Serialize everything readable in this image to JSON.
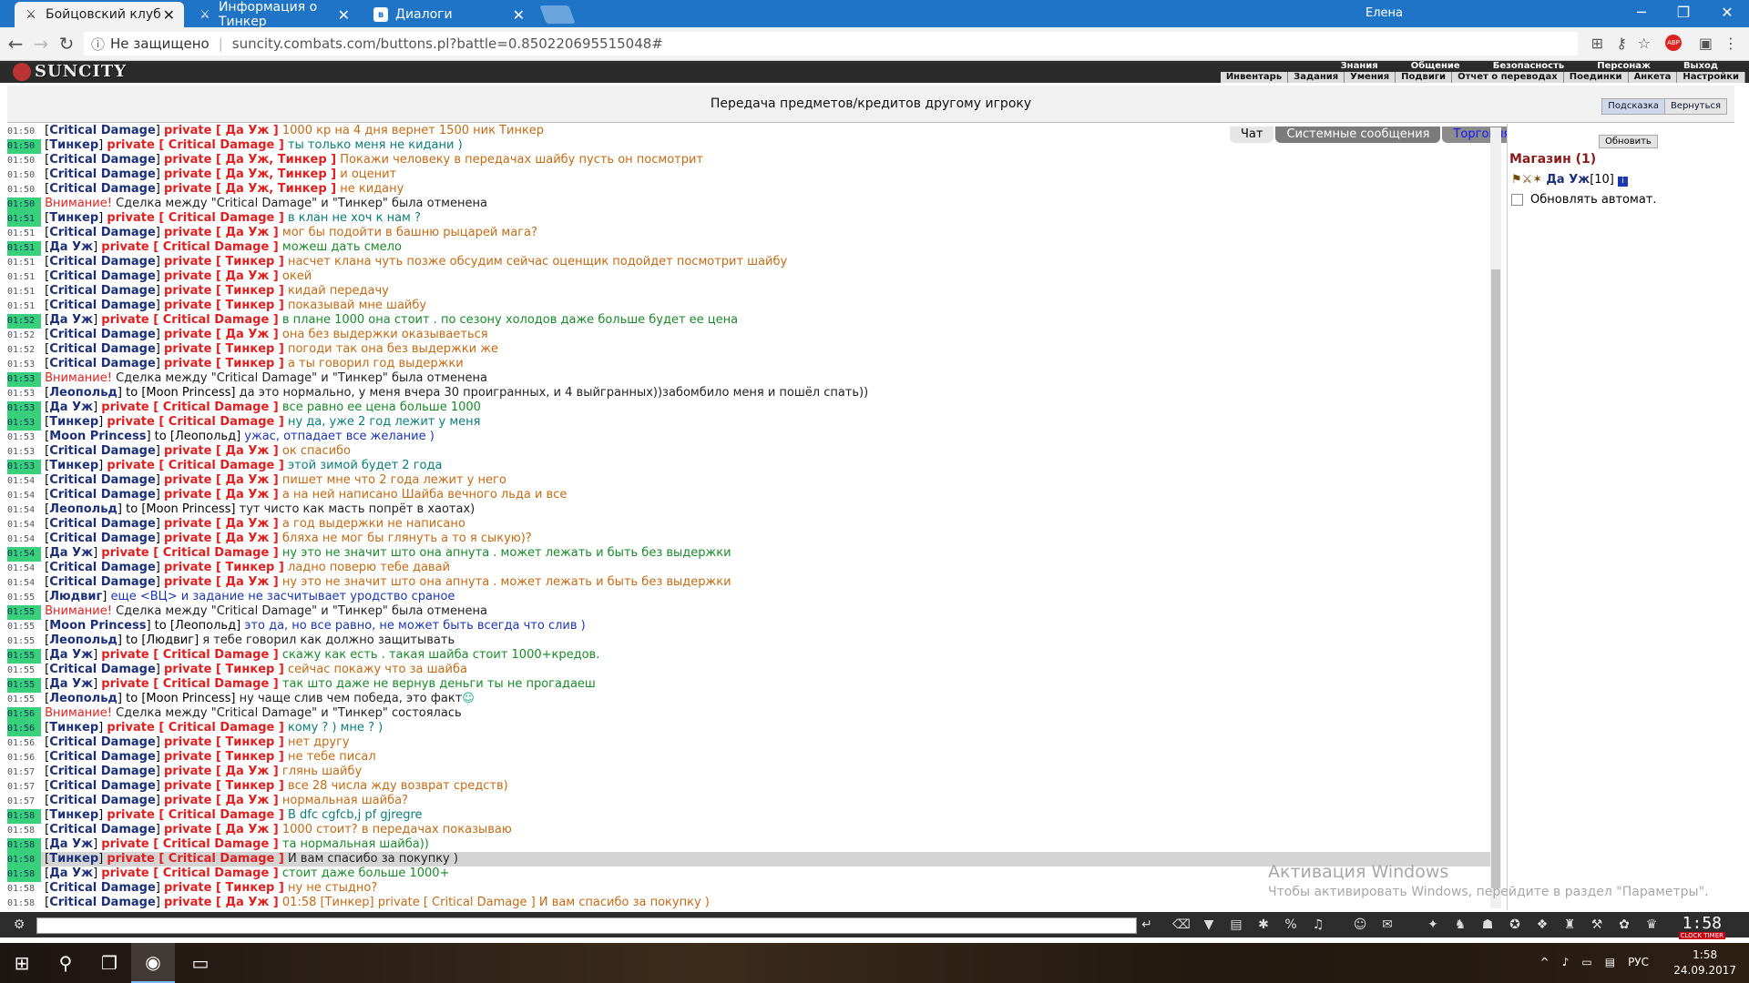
{
  "browser": {
    "tabs": [
      {
        "title": "Бойцовский клуб",
        "active": true
      },
      {
        "title": "Информация о Тинкер",
        "active": false
      },
      {
        "title": "Диалоги",
        "active": false
      }
    ],
    "window_user": "Елена",
    "security": "Не защищено",
    "url": "suncity.combats.com/buttons.pl?battle=0.850220695515048#"
  },
  "site": {
    "logo": "SUNCITY",
    "menu_top": [
      "Знания",
      "Общение",
      "Безопасность",
      "Персонаж",
      "Выход"
    ],
    "menu_bottom": [
      "Инвентарь",
      "Задания",
      "Умения",
      "Подвиги",
      "Отчет о переводах",
      "Поединки",
      "Анкета",
      "Настройки"
    ]
  },
  "page": {
    "title": "Передача предметов/кредитов другому игроку",
    "hint_button": "Подсказка",
    "back_button": "Вернуться"
  },
  "chat_tabs": [
    "Чат",
    "Системные сообщения",
    "Торговля"
  ],
  "right_panel": {
    "refresh_button": "Обновить",
    "shop_title": "Магазин (1)",
    "shop_user": "Да Уж",
    "shop_user_level": "[10]",
    "auto_refresh_label": "Обновлять автомат."
  },
  "chat": [
    {
      "t": "01:50",
      "g": false,
      "from": "Critical Damage",
      "to": "Да Уж",
      "text": "1000 кр на 4 дня вернет 1500 ник Тинкер",
      "c": "o"
    },
    {
      "t": "01:50",
      "g": true,
      "from": "Тинкер",
      "to": "Critical Damage",
      "text": "ты только меня не кидани )",
      "c": "t"
    },
    {
      "t": "01:50",
      "g": false,
      "from": "Critical Damage",
      "to": "Да Уж, Тинкер",
      "text": "Покажи человеку в передачах шайбу пусть он посмотрит",
      "c": "o"
    },
    {
      "t": "01:50",
      "g": false,
      "from": "Critical Damage",
      "to": "Да Уж, Тинкер",
      "text": "и оценит",
      "c": "o"
    },
    {
      "t": "01:50",
      "g": false,
      "from": "Critical Damage",
      "to": "Да Уж, Тинкер",
      "text": "не кидану",
      "c": "o"
    },
    {
      "t": "01:50",
      "g": true,
      "warn": "Внимание!",
      "sys": "Сделка между \"Critical Damage\" и \"Тинкер\" была отменена"
    },
    {
      "t": "01:51",
      "g": true,
      "from": "Тинкер",
      "to": "Critical Damage",
      "text": "в клан не хоч к нам ?",
      "c": "t"
    },
    {
      "t": "01:51",
      "g": false,
      "from": "Critical Damage",
      "to": "Да Уж",
      "text": "мог бы подойти в башню рыцарей мага?",
      "c": "o"
    },
    {
      "t": "01:51",
      "g": true,
      "from": "Да Уж",
      "to": "Critical Damage",
      "text": "можеш дать смело",
      "c": "g"
    },
    {
      "t": "01:51",
      "g": false,
      "from": "Critical Damage",
      "to": "Тинкер",
      "text": "насчет клана чуть позже обсудим сейчас оценщик подойдет посмотрит шайбу",
      "c": "o"
    },
    {
      "t": "01:51",
      "g": false,
      "from": "Critical Damage",
      "to": "Да Уж",
      "text": "окей",
      "c": "o"
    },
    {
      "t": "01:51",
      "g": false,
      "from": "Critical Damage",
      "to": "Тинкер",
      "text": "кидай передачу",
      "c": "o"
    },
    {
      "t": "01:51",
      "g": false,
      "from": "Critical Damage",
      "to": "Тинкер",
      "text": "показывай мне шайбу",
      "c": "o"
    },
    {
      "t": "01:52",
      "g": true,
      "from": "Да Уж",
      "to": "Critical Damage",
      "text": "в плане 1000 она стоит . по сезону холодов даже больше будет ее цена",
      "c": "g"
    },
    {
      "t": "01:52",
      "g": false,
      "from": "Critical Damage",
      "to": "Да Уж",
      "text": "она без выдержки оказываеться",
      "c": "o"
    },
    {
      "t": "01:52",
      "g": false,
      "from": "Critical Damage",
      "to": "Тинкер",
      "text": "погоди так она без выдержки же",
      "c": "o"
    },
    {
      "t": "01:53",
      "g": false,
      "from": "Critical Damage",
      "to": "Тинкер",
      "text": "а ты говорил год выдержки",
      "c": "o"
    },
    {
      "t": "01:53",
      "g": true,
      "warn": "Внимание!",
      "sys": "Сделка между \"Critical Damage\" и \"Тинкер\" была отменена"
    },
    {
      "t": "01:53",
      "g": false,
      "pub": "Леопольд",
      "pubto": "Moon Princess",
      "text": "да это нормально, у меня вчера 30 проигранных, и 4 выйгранных))забомбило меня и пошёл спать))",
      "c": "k"
    },
    {
      "t": "01:53",
      "g": true,
      "from": "Да Уж",
      "to": "Critical Damage",
      "text": "все равно ее цена больше 1000",
      "c": "g"
    },
    {
      "t": "01:53",
      "g": true,
      "from": "Тинкер",
      "to": "Critical Damage",
      "text": "ну да, уже 2 год лежит у меня",
      "c": "t"
    },
    {
      "t": "01:53",
      "g": false,
      "pub": "Moon Princess",
      "pubto": "Леопольд",
      "text": "ужас, отпадает все желание )",
      "c": "b"
    },
    {
      "t": "01:53",
      "g": false,
      "from": "Critical Damage",
      "to": "Да Уж",
      "text": "ок спасибо",
      "c": "o"
    },
    {
      "t": "01:53",
      "g": true,
      "from": "Тинкер",
      "to": "Critical Damage",
      "text": "этой зимой будет 2 года",
      "c": "t"
    },
    {
      "t": "01:54",
      "g": false,
      "from": "Critical Damage",
      "to": "Да Уж",
      "text": "пишет мне что 2 года лежит у него",
      "c": "o"
    },
    {
      "t": "01:54",
      "g": false,
      "from": "Critical Damage",
      "to": "Да Уж",
      "text": "а на ней написано Шайба вечного льда и все",
      "c": "o"
    },
    {
      "t": "01:54",
      "g": false,
      "pub": "Леопольд",
      "pubto": "Moon Princess",
      "text": "тут чисто как масть попрёт в хаотах)",
      "c": "k"
    },
    {
      "t": "01:54",
      "g": false,
      "from": "Critical Damage",
      "to": "Да Уж",
      "text": "а год выдержки не написано",
      "c": "o"
    },
    {
      "t": "01:54",
      "g": false,
      "from": "Critical Damage",
      "to": "Да Уж",
      "text": "бляха не мог бы глянуть а то я сыкую)?",
      "c": "o"
    },
    {
      "t": "01:54",
      "g": true,
      "from": "Да Уж",
      "to": "Critical Damage",
      "text": "ну это не значит што она апнута . может лежать и быть без выдержки",
      "c": "g"
    },
    {
      "t": "01:54",
      "g": false,
      "from": "Critical Damage",
      "to": "Тинкер",
      "text": "ладно поверю тебе давай",
      "c": "o"
    },
    {
      "t": "01:54",
      "g": false,
      "from": "Critical Damage",
      "to": "Да Уж",
      "text": "ну это не значит што она апнута . может лежать и быть без выдержки",
      "c": "o"
    },
    {
      "t": "01:55",
      "g": false,
      "pub": "Людвиг",
      "text": "еще <ВЦ> и задание не засчитывает уродство сраное",
      "c": "b"
    },
    {
      "t": "01:55",
      "g": true,
      "warn": "Внимание!",
      "sys": "Сделка между \"Critical Damage\" и \"Тинкер\" была отменена"
    },
    {
      "t": "01:55",
      "g": false,
      "pub": "Moon Princess",
      "pubto": "Леопольд",
      "text": "это да, но все равно, не может быть всегда что слив )",
      "c": "b"
    },
    {
      "t": "01:55",
      "g": false,
      "pub": "Леопольд",
      "pubto": "Людвиг",
      "text": "я тебе говорил как должно защитывать",
      "c": "k"
    },
    {
      "t": "01:55",
      "g": true,
      "from": "Да Уж",
      "to": "Critical Damage",
      "text": "скажу как есть . такая шайба стоит 1000+кредов.",
      "c": "g"
    },
    {
      "t": "01:55",
      "g": false,
      "from": "Critical Damage",
      "to": "Тинкер",
      "text": "сейчас покажу что за шайба",
      "c": "o"
    },
    {
      "t": "01:55",
      "g": true,
      "from": "Да Уж",
      "to": "Critical Damage",
      "text": "так што даже не вернув деньги ты не прогадаеш",
      "c": "g"
    },
    {
      "t": "01:55",
      "g": false,
      "pub": "Леопольд",
      "pubto": "Moon Princess",
      "text": "ну чаще слив чем победа, это факт",
      "c": "k",
      "smile": true
    },
    {
      "t": "01:56",
      "g": true,
      "warn": "Внимание!",
      "sys": "Сделка между \"Critical Damage\" и \"Тинкер\" состоялась"
    },
    {
      "t": "01:56",
      "g": true,
      "from": "Тинкер",
      "to": "Critical Damage",
      "text": "кому ? ) мне ? )",
      "c": "t"
    },
    {
      "t": "01:56",
      "g": false,
      "from": "Critical Damage",
      "to": "Тинкер",
      "text": "нет другу",
      "c": "o"
    },
    {
      "t": "01:56",
      "g": false,
      "from": "Critical Damage",
      "to": "Тинкер",
      "text": "не тебе писал",
      "c": "o"
    },
    {
      "t": "01:57",
      "g": false,
      "from": "Critical Damage",
      "to": "Да Уж",
      "text": "глянь шайбу",
      "c": "o"
    },
    {
      "t": "01:57",
      "g": false,
      "from": "Critical Damage",
      "to": "Тинкер",
      "text": "все 28 числа жду возврат средств)",
      "c": "o"
    },
    {
      "t": "01:57",
      "g": false,
      "from": "Critical Damage",
      "to": "Да Уж",
      "text": "нормальная шайба?",
      "c": "o"
    },
    {
      "t": "01:58",
      "g": true,
      "from": "Тинкер",
      "to": "Critical Damage",
      "text": "В dfc cgfcb,j pf gjregre",
      "c": "t"
    },
    {
      "t": "01:58",
      "g": false,
      "from": "Critical Damage",
      "to": "Да Уж",
      "text": "1000 стоит? в передачах показываю",
      "c": "o"
    },
    {
      "t": "01:58",
      "g": true,
      "from": "Да Уж",
      "to": "Critical Damage",
      "text": "та нормальная шайба))",
      "c": "g"
    },
    {
      "t": "01:58",
      "g": true,
      "from": "Тинкер",
      "to": "Critical Damage",
      "text": "И вам спасибо за покупку )",
      "c": "k",
      "sel": true
    },
    {
      "t": "01:58",
      "g": true,
      "from": "Да Уж",
      "to": "Critical Damage",
      "text": "стоит даже больше 1000+",
      "c": "g"
    },
    {
      "t": "01:58",
      "g": false,
      "from": "Critical Damage",
      "to": "Тинкер",
      "text": "ну не стыдно?",
      "c": "o"
    },
    {
      "t": "01:58",
      "g": false,
      "from": "Critical Damage",
      "to": "Да Уж",
      "text": "01:58 [Тинкер] private [ Critical Damage ] И вам спасибо за покупку )",
      "c": "o"
    }
  ],
  "bottom_clock": "1:58",
  "bottom_clock_label": "CLOCK TIMER",
  "windows": {
    "activation_title": "Активация Windows",
    "activation_sub": "Чтобы активировать Windows, перейдите в раздел \"Параметры\".",
    "lang": "РУС",
    "time": "1:58",
    "date": "24.09.2017"
  },
  "private_label": "private"
}
